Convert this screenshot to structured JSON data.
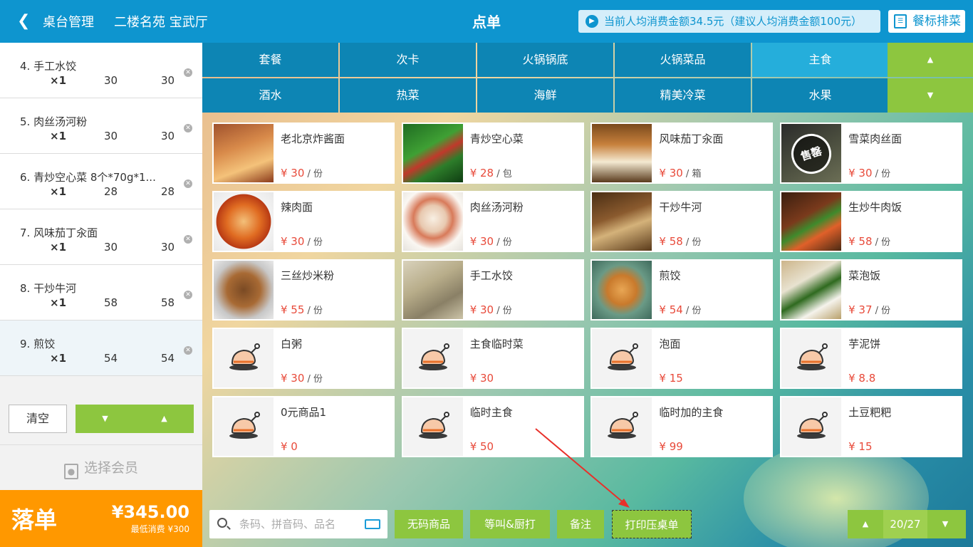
{
  "header": {
    "back_icon": "chevron-left-icon",
    "table_mgmt": "桌台管理",
    "location": "二楼名苑 宝武厅",
    "title": "点单",
    "notice": "当前人均消费金额34.5元（建议人均消费金额100元）",
    "rank_label": "餐标排菜"
  },
  "order_items": [
    {
      "name": "4. 手工水饺",
      "qty": "×1",
      "price": "30",
      "total": "30"
    },
    {
      "name": "5. 肉丝汤河粉",
      "qty": "×1",
      "price": "30",
      "total": "30"
    },
    {
      "name": "6. 青炒空心菜 8个*70g*1...",
      "qty": "×1",
      "price": "28",
      "total": "28"
    },
    {
      "name": "7. 风味茄丁汆面",
      "qty": "×1",
      "price": "30",
      "total": "30"
    },
    {
      "name": "8. 干炒牛河",
      "qty": "×1",
      "price": "58",
      "total": "58"
    },
    {
      "name": "9. 煎饺",
      "qty": "×1",
      "price": "54",
      "total": "54"
    }
  ],
  "left_controls": {
    "clear": "清空",
    "member": "选择会员",
    "submit": "落单",
    "amount": "¥345.00",
    "min_consume": "最低消费 ¥300"
  },
  "tabs_row1": [
    "套餐",
    "次卡",
    "火锅锅底",
    "火锅菜品",
    "主食"
  ],
  "tabs_row2": [
    "酒水",
    "热菜",
    "海鲜",
    "精美冷菜",
    "水果"
  ],
  "active_tab": "主食",
  "products": [
    {
      "name": "老北京炸酱面",
      "price": "¥ 30",
      "unit": " / 份",
      "img": "noodles"
    },
    {
      "name": "青炒空心菜",
      "price": "¥ 28",
      "unit": " / 包",
      "img": "greens"
    },
    {
      "name": "风味茄丁汆面",
      "price": "¥ 30",
      "unit": " / 箱",
      "img": "rice"
    },
    {
      "name": "雪菜肉丝面",
      "price": "¥ 30",
      "unit": " / 份",
      "img": "dark",
      "sold_out": "售罄"
    },
    {
      "name": "辣肉面",
      "price": "¥ 30",
      "unit": " / 份",
      "img": "spicy"
    },
    {
      "name": "肉丝汤河粉",
      "price": "¥ 30",
      "unit": " / 份",
      "img": "soup"
    },
    {
      "name": "干炒牛河",
      "price": "¥ 58",
      "unit": " / 份",
      "img": "fried"
    },
    {
      "name": "生炒牛肉饭",
      "price": "¥ 58",
      "unit": " / 份",
      "img": "beef"
    },
    {
      "name": "三丝炒米粉",
      "price": "¥ 55",
      "unit": " / 份",
      "img": "vermicelli"
    },
    {
      "name": "手工水饺",
      "price": "¥ 30",
      "unit": " / 份",
      "img": "dumpling"
    },
    {
      "name": "煎饺",
      "price": "¥ 54",
      "unit": " / 份",
      "img": "potsticker"
    },
    {
      "name": "菜泡饭",
      "price": "¥ 37",
      "unit": " / 份",
      "img": "porridge"
    },
    {
      "name": "白粥",
      "price": "¥ 30",
      "unit": " / 份",
      "img": "placeholder"
    },
    {
      "name": "主食临时菜",
      "price": "¥ 30",
      "unit": "",
      "img": "placeholder"
    },
    {
      "name": "泡面",
      "price": "¥ 15",
      "unit": "",
      "img": "placeholder"
    },
    {
      "name": "芋泥饼",
      "price": "¥ 8.8",
      "unit": "",
      "img": "placeholder"
    },
    {
      "name": "0元商品1",
      "price": "¥ 0",
      "unit": "",
      "img": "placeholder"
    },
    {
      "name": "临时主食",
      "price": "¥ 50",
      "unit": "",
      "img": "placeholder"
    },
    {
      "name": "临时加的主食",
      "price": "¥ 99",
      "unit": "",
      "img": "placeholder"
    },
    {
      "name": "土豆粑粑",
      "price": "¥ 15",
      "unit": "",
      "img": "placeholder"
    }
  ],
  "toolbar": {
    "search_placeholder": "条码、拼音码、品名",
    "no_code": "无码商品",
    "call_kitchen": "等叫&厨打",
    "remark": "备注",
    "print": "打印压桌单",
    "page": "20/27"
  },
  "colors": {
    "header_blue": "#0e95cf",
    "tab_blue": "#0d85b4",
    "tab_active": "#25aedb",
    "green": "#8dc63f",
    "orange": "#ff9800",
    "price_red": "#e84a3a"
  }
}
